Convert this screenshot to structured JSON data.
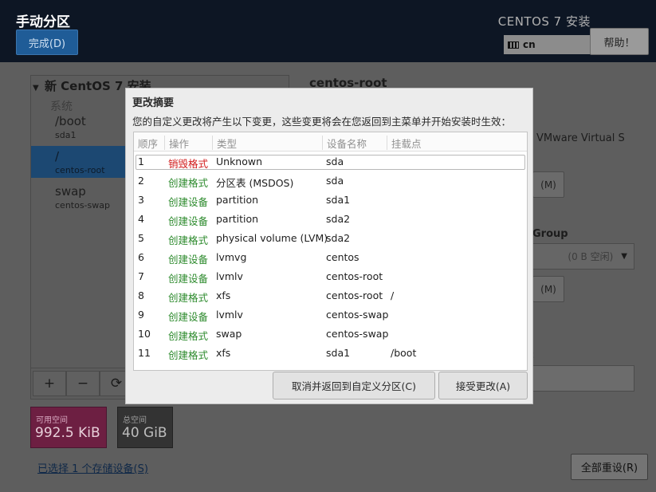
{
  "header": {
    "title": "手动分区",
    "done_label": "完成(D)",
    "install_title": "CENTOS 7 安装",
    "keyboard_layout": "cn",
    "help_label": "帮助！"
  },
  "left_panel": {
    "group_title": "新 CentOS 7 安装",
    "system_label": "系统",
    "mounts": [
      {
        "name": "/boot",
        "device": "sda1",
        "selected": false
      },
      {
        "name": "/",
        "device": "centos-root",
        "selected": true
      },
      {
        "name": "swap",
        "device": "centos-swap",
        "selected": false
      }
    ],
    "tools": {
      "add": "+",
      "remove": "−",
      "refresh": "⟳"
    }
  },
  "space": {
    "available_label": "可用空间",
    "available_value": "992.5 KiB",
    "total_label": "总空间",
    "total_value": "40 GiB"
  },
  "storage_link": "已选择 1 个存储设备(S)",
  "right_panel": {
    "title": "centos-root",
    "device_desc": "VMware Virtual S",
    "modify_label": "(M)",
    "volume_group_label": "Group",
    "volume_group_value": "(0 B 空闲)",
    "modify_label_2": "(M)",
    "colon": ":",
    "reset_label": "全部重设(R)"
  },
  "dialog": {
    "title": "更改摘要",
    "description": "您的自定义更改将产生以下变更，这些变更将会在您返回到主菜单并开始安装时生效：",
    "columns": [
      "顺序",
      "操作",
      "类型",
      "设备名称",
      "挂载点"
    ],
    "rows": [
      {
        "order": "1",
        "action": "销毁格式",
        "action_kind": "destroy",
        "type": "Unknown",
        "device": "sda",
        "mount": ""
      },
      {
        "order": "2",
        "action": "创建格式",
        "action_kind": "create",
        "type": "分区表 (MSDOS)",
        "device": "sda",
        "mount": ""
      },
      {
        "order": "3",
        "action": "创建设备",
        "action_kind": "create",
        "type": "partition",
        "device": "sda1",
        "mount": ""
      },
      {
        "order": "4",
        "action": "创建设备",
        "action_kind": "create",
        "type": "partition",
        "device": "sda2",
        "mount": ""
      },
      {
        "order": "5",
        "action": "创建格式",
        "action_kind": "create",
        "type": "physical volume (LVM)",
        "device": "sda2",
        "mount": ""
      },
      {
        "order": "6",
        "action": "创建设备",
        "action_kind": "create",
        "type": "lvmvg",
        "device": "centos",
        "mount": ""
      },
      {
        "order": "7",
        "action": "创建设备",
        "action_kind": "create",
        "type": "lvmlv",
        "device": "centos-root",
        "mount": ""
      },
      {
        "order": "8",
        "action": "创建格式",
        "action_kind": "create",
        "type": "xfs",
        "device": "centos-root",
        "mount": "/"
      },
      {
        "order": "9",
        "action": "创建设备",
        "action_kind": "create",
        "type": "lvmlv",
        "device": "centos-swap",
        "mount": ""
      },
      {
        "order": "10",
        "action": "创建格式",
        "action_kind": "create",
        "type": "swap",
        "device": "centos-swap",
        "mount": ""
      },
      {
        "order": "11",
        "action": "创建格式",
        "action_kind": "create",
        "type": "xfs",
        "device": "sda1",
        "mount": "/boot"
      }
    ],
    "cancel_label": "取消并返回到自定义分区(C)",
    "accept_label": "接受更改(A)"
  },
  "colors": {
    "destroy": "#d11a1a",
    "create": "#2c8a2c",
    "header_bg": "#0d1624",
    "accent": "#1f5c97"
  }
}
